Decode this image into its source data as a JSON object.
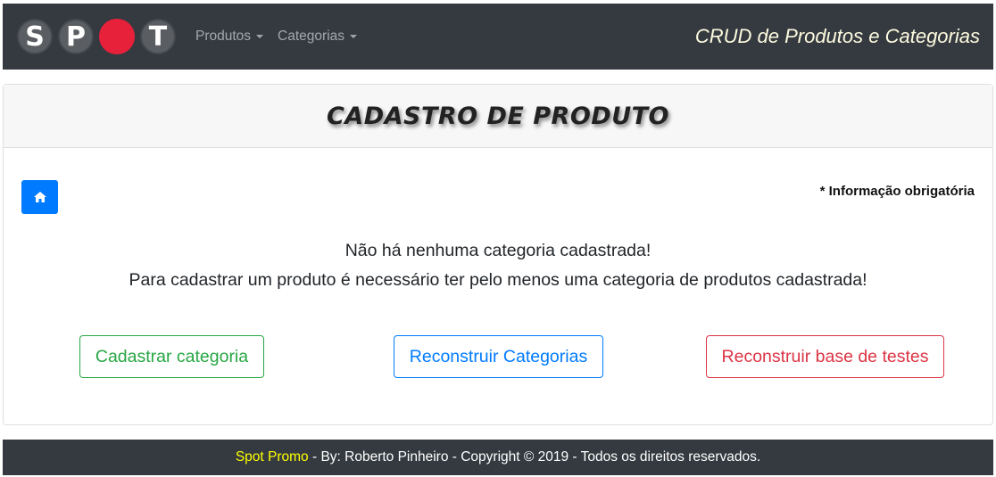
{
  "navbar": {
    "logo_letters": [
      "S",
      "P",
      "",
      "T"
    ],
    "menu": [
      {
        "label": "Produtos"
      },
      {
        "label": "Categorias"
      }
    ],
    "brand_text": "CRUD de Produtos e Categorias"
  },
  "card": {
    "title": "CADASTRO DE PRODUTO",
    "home_icon": "home-icon",
    "required_note": "* Informação obrigatória",
    "message_line1": "Não há nenhuma categoria cadastrada!",
    "message_line2": "Para cadastrar um produto é necessário ter pelo menos uma categoria de produtos cadastrada!",
    "buttons": {
      "register_category": "Cadastrar categoria",
      "rebuild_categories": "Reconstruir Categorias",
      "rebuild_test_base": "Reconstruir base de testes"
    }
  },
  "footer": {
    "brand": "Spot Promo",
    "text": " - By: Roberto Pinheiro - Copyright © 2019 - Todos os direitos reservados."
  },
  "colors": {
    "navbar_bg": "#343a40",
    "primary": "#007bff",
    "success": "#28a745",
    "danger": "#dc3545",
    "logo_red": "#e8213b",
    "footer_brand": "#ffff00"
  }
}
